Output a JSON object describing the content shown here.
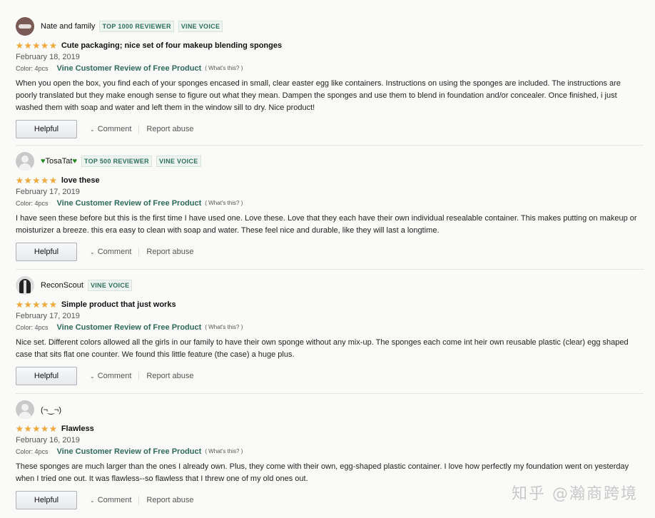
{
  "reviews": [
    {
      "name": "Nate and family",
      "badges": [
        "TOP 1000 REVIEWER",
        "VINE VOICE"
      ],
      "rating": 5,
      "title": "Cute packaging; nice set of four makeup blending sponges",
      "date": "February 18, 2019",
      "color": "Color: 4pcs",
      "vine": "Vine Customer Review of Free Product",
      "whats": "( What's this? )",
      "body": "When you open the box, you find each of your sponges encased in small, clear easter egg like containers. Instructions on using the sponges are included. The instructions are poorly translated but they make enough sense to figure out what they mean. Dampen the sponges and use them to blend in foundation and/or concealer. Once finished, i just washed them with soap and water and left them in the window sill to dry. Nice product!",
      "helpful": "Helpful",
      "comment": "Comment",
      "abuse": "Report abuse"
    },
    {
      "name": "TosaTat",
      "badges": [
        "TOP 500 REVIEWER",
        "VINE VOICE"
      ],
      "rating": 5,
      "title": "love these",
      "date": "February 17, 2019",
      "color": "Color: 4pcs",
      "vine": "Vine Customer Review of Free Product",
      "whats": "( What's this? )",
      "body": "I have seen these before but this is the first time I have used one. Love these. Love that they each have their own individual resealable container. This makes putting on makeup or moisturizer a breeze. this era easy to clean with soap and water. These feel nice and durable, like they will last a longtime.",
      "helpful": "Helpful",
      "comment": "Comment",
      "abuse": "Report abuse"
    },
    {
      "name": "ReconScout",
      "badges": [
        "VINE VOICE"
      ],
      "rating": 5,
      "title": "Simple product that just works",
      "date": "February 17, 2019",
      "color": "Color: 4pcs",
      "vine": "Vine Customer Review of Free Product",
      "whats": "( What's this? )",
      "body": "Nice set. Different colors allowed all the girls in our family to have their own sponge without any mix-up. The sponges each come int heir own reusable plastic (clear) egg shaped case that sits flat one counter. We found this little feature (the case) a huge plus.",
      "helpful": "Helpful",
      "comment": "Comment",
      "abuse": "Report abuse"
    },
    {
      "name": "(¬‿¬)",
      "badges": [],
      "rating": 5,
      "title": "Flawless",
      "date": "February 16, 2019",
      "color": "Color: 4pcs",
      "vine": "Vine Customer Review of Free Product",
      "whats": "( What's this? )",
      "body": "These sponges are much larger than the ones I already own. Plus, they come with their own, egg-shaped plastic container. I love how perfectly my foundation went on yesterday when I tried one out. It was flawless--so flawless that I threw one of my old ones out.",
      "helpful": "Helpful",
      "comment": "Comment",
      "abuse": "Report abuse"
    }
  ],
  "watermark": "知乎 @瀚商跨境",
  "colors": {
    "star": "#f0a93a",
    "vine_link": "#2e6a5c",
    "badge": "#2e6f5e"
  }
}
